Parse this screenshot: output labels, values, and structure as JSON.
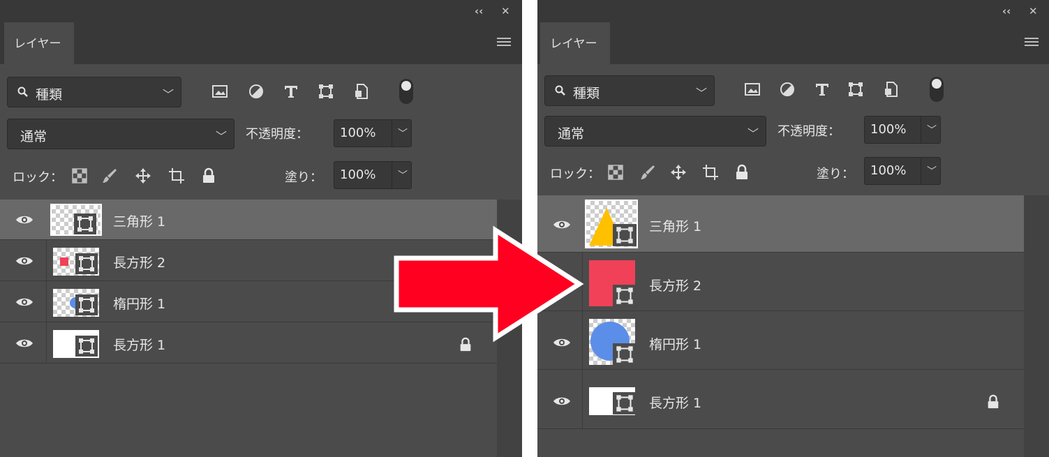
{
  "colors": {
    "panel_bg": "#4b4b4b",
    "header_bg": "#383838",
    "selected_row": "#696969",
    "arrow": "#ff0020",
    "triangle": "#ffc000",
    "rectangle": "#f04158",
    "ellipse": "#5b8ee8"
  },
  "icons": {
    "collapse": "double-chevron-left-icon",
    "close": "close-icon",
    "panel_menu": "hamburger-menu-icon",
    "filter": [
      "image-filter-icon",
      "adjustment-filter-icon",
      "type-filter-icon",
      "shape-filter-icon",
      "smart-object-filter-icon"
    ],
    "lock": [
      "lock-transparent-pixels-icon",
      "lock-image-pixels-icon",
      "lock-position-icon",
      "lock-artboard-icon",
      "lock-all-icon"
    ]
  },
  "left_panel": {
    "titlebar": {
      "collapse_glyph": "‹‹",
      "close_glyph": "✕"
    },
    "tab_label": "レイヤー",
    "filter_kind": "種類",
    "blend_mode": "通常",
    "opacity_label": "不透明度：",
    "opacity_value": "100%",
    "lock_label": "ロック：",
    "fill_label": "塗り：",
    "fill_value": "100%",
    "layers": [
      {
        "name": "三角形 1",
        "selected": true
      },
      {
        "name": "長方形 2",
        "selected": false
      },
      {
        "name": "楕円形 1",
        "selected": false
      },
      {
        "name": "長方形 1",
        "selected": false,
        "locked": true
      }
    ]
  },
  "right_panel": {
    "titlebar": {
      "collapse_glyph": "‹‹",
      "close_glyph": "✕"
    },
    "tab_label": "レイヤー",
    "filter_kind": "種類",
    "blend_mode": "通常",
    "opacity_label": "不透明度：",
    "opacity_value": "100%",
    "lock_label": "ロック：",
    "fill_label": "塗り：",
    "fill_value": "100%",
    "layers": [
      {
        "name": "三角形 1",
        "selected": true
      },
      {
        "name": "長方形 2",
        "selected": false
      },
      {
        "name": "楕円形 1",
        "selected": false
      },
      {
        "name": "長方形 1",
        "selected": false,
        "locked": true
      }
    ]
  }
}
